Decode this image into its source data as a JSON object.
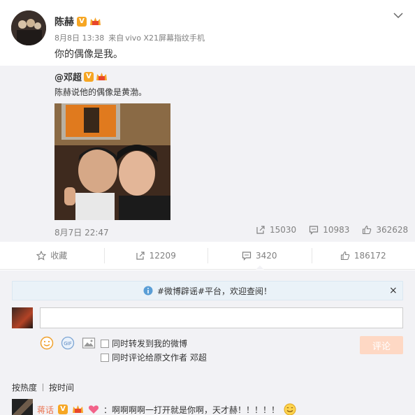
{
  "post": {
    "author": "陈赫",
    "date": "8月8日 13:38",
    "source_prefix": "来自",
    "source": "vivo X21屏幕指纹手机",
    "text": "你的偶像是我。"
  },
  "repost": {
    "author": "@邓超",
    "text": "陈赫说他的偶像是黄渤。",
    "date": "8月7日 22:47",
    "reposts": "15030",
    "comments": "10983",
    "likes": "362628"
  },
  "actions": {
    "favorite": "收藏",
    "repost": "12209",
    "comment": "3420",
    "like": "186172"
  },
  "comment_box": {
    "notice": "#微博辟谣#平台，欢迎查阅！",
    "close": "×",
    "input_placeholder": "",
    "check_repost": "同时转发到我的微博",
    "check_comment_origin": "同时评论给原文作者 邓超",
    "submit": "评论"
  },
  "sort": {
    "by_hot": "按热度",
    "by_time": "按时间"
  },
  "first_comment": {
    "author": "蒋话",
    "text": "：啊啊啊啊一打开就是你啊，天才赫！！！！！"
  },
  "colors": {
    "accent": "#eb7350",
    "v_badge": "#f6a623",
    "submit_disabled": "#fed8c4",
    "repost_bg": "#f2f2f5"
  }
}
